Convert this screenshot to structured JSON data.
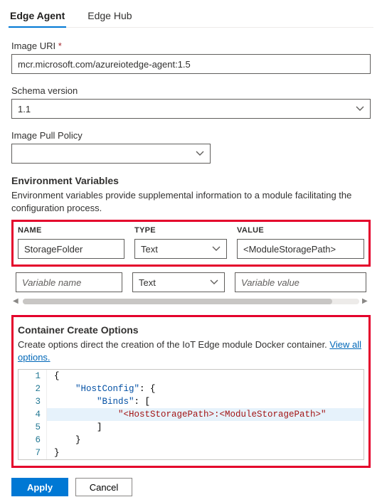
{
  "tabs": {
    "items": [
      {
        "label": "Edge Agent",
        "active": true
      },
      {
        "label": "Edge Hub",
        "active": false
      }
    ]
  },
  "fields": {
    "image_uri": {
      "label": "Image URI",
      "required_mark": "*",
      "value": "mcr.microsoft.com/azureiotedge-agent:1.5"
    },
    "schema_version": {
      "label": "Schema version",
      "value": "1.1"
    },
    "image_pull_policy": {
      "label": "Image Pull Policy",
      "value": ""
    }
  },
  "env": {
    "title": "Environment Variables",
    "description": "Environment variables provide supplemental information to a module facilitating the configuration process.",
    "headers": {
      "name": "NAME",
      "type": "TYPE",
      "value": "VALUE"
    },
    "rows": [
      {
        "name": "StorageFolder",
        "type": "Text",
        "value": "<ModuleStoragePath>"
      }
    ],
    "new_row": {
      "name_placeholder": "Variable name",
      "type_value": "Text",
      "value_placeholder": "Variable value"
    }
  },
  "create_options": {
    "title": "Container Create Options",
    "description_prefix": "Create options direct the creation of the IoT Edge module Docker container. ",
    "link_text": "View all options.",
    "code_lines": [
      "{",
      "    \"HostConfig\": {",
      "        \"Binds\": [",
      "            \"<HostStoragePath>:<ModuleStoragePath>\"",
      "        ]",
      "    }",
      "}"
    ],
    "highlight_line_index": 3
  },
  "buttons": {
    "apply": "Apply",
    "cancel": "Cancel"
  }
}
